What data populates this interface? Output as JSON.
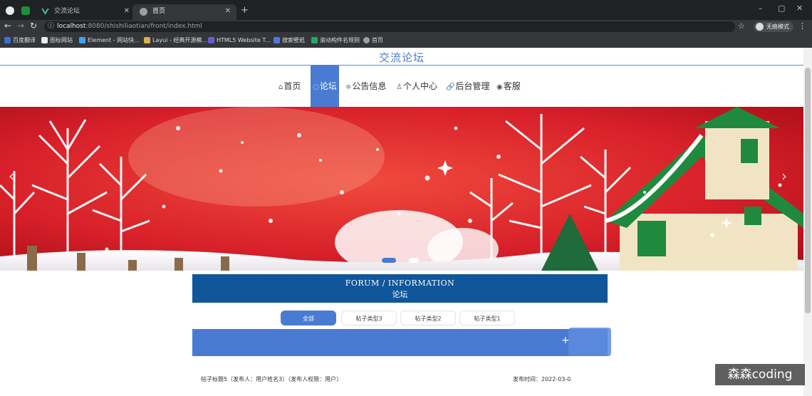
{
  "browser": {
    "tabs": [
      {
        "title": "交流论坛",
        "active": false
      },
      {
        "title": "首页",
        "active": true
      }
    ],
    "new_tab_symbol": "+",
    "window_controls": [
      "–",
      "▢",
      "✕"
    ],
    "address": {
      "host": "localhost",
      "path": ":8080/shishiliaotian/front/index.html"
    },
    "profile_label": "无痕模式",
    "bookmarks": [
      {
        "label": "百度翻译",
        "color": "#3b6fd8"
      },
      {
        "label": "图标网站",
        "color": "#e8eaed"
      },
      {
        "label": "Element - 网站快...",
        "color": "#3ea1f2"
      },
      {
        "label": "Layui - 经典开源模...",
        "color": "#d4b24a"
      },
      {
        "label": "HTML5 Website T...",
        "color": "#6a5acd"
      },
      {
        "label": "搜索壁纸",
        "color": "#5577dd"
      },
      {
        "label": "滚动构件名规则",
        "color": "#22aa66"
      },
      {
        "label": "首页",
        "color": "#9aa0a6"
      }
    ]
  },
  "site": {
    "title": "交流论坛",
    "nav": [
      {
        "icon": "home-icon",
        "glyph": "⌂",
        "label": "首页",
        "active": false
      },
      {
        "icon": "forum-icon",
        "glyph": "◌",
        "label": "论坛",
        "active": true
      },
      {
        "icon": "notice-icon",
        "glyph": "≑",
        "label": "公告信息",
        "active": false
      },
      {
        "icon": "user-icon",
        "glyph": "♙",
        "label": "个人中心",
        "active": false
      },
      {
        "icon": "link-icon",
        "glyph": "🔗",
        "label": "后台管理",
        "active": false
      },
      {
        "icon": "support-icon",
        "glyph": "◉",
        "label": "客服",
        "active": false
      }
    ],
    "carousel": {
      "prev": "‹",
      "next": "›",
      "slides": 2,
      "active_slide": 0
    }
  },
  "forum": {
    "header_en": "FORUM / INFORMATION",
    "header_zh": "论坛",
    "filters": [
      {
        "label": "全部",
        "active": true
      },
      {
        "label": "帖子类型3",
        "active": false
      },
      {
        "label": "帖子类型2",
        "active": false
      },
      {
        "label": "帖子类型1",
        "active": false
      }
    ],
    "add_symbol": "+",
    "posts": [
      {
        "title": "帖子标题5（发布人：用户姓名3）（发布人权限：用户）",
        "time": "发布时间：2022-03-0"
      }
    ]
  },
  "watermark": "森森coding",
  "colors": {
    "accent": "#4a7bd2",
    "header": "#10569a",
    "chrome_dark": "#202124"
  }
}
